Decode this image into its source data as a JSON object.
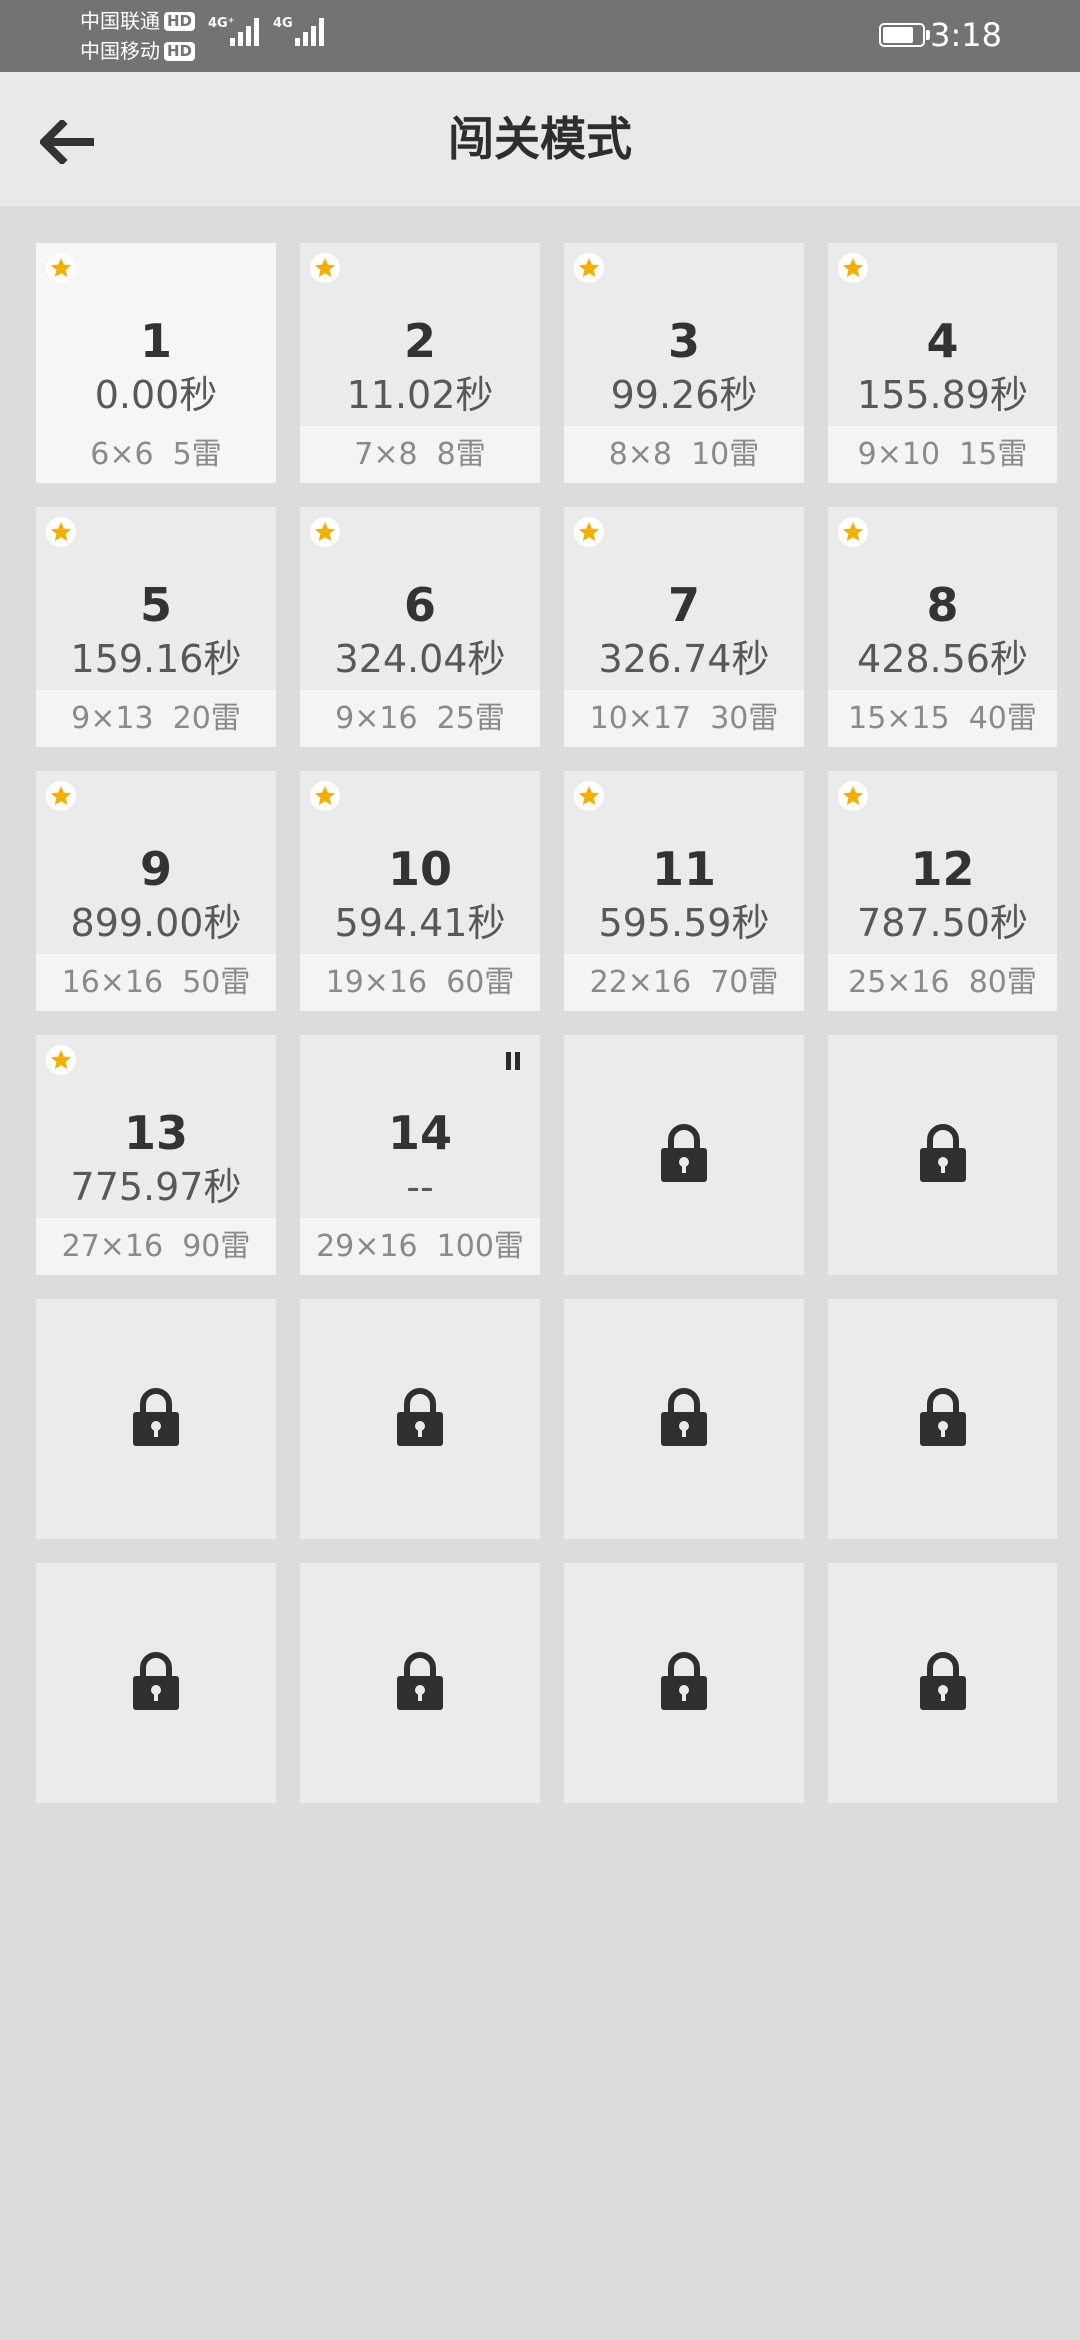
{
  "status_bar": {
    "carrier1": "中国联通",
    "carrier2": "中国移动",
    "hd_label": "HD",
    "net1": "4G⁺",
    "net2": "4G",
    "time": "3:18",
    "battery_level": 0.8
  },
  "header": {
    "title": "闯关模式",
    "back_icon": "arrow-left-icon"
  },
  "levels": [
    {
      "num": "1",
      "time": "0.00秒",
      "size": "6×6",
      "mines": "5雷",
      "state": "completed"
    },
    {
      "num": "2",
      "time": "11.02秒",
      "size": "7×8",
      "mines": "8雷",
      "state": "completed"
    },
    {
      "num": "3",
      "time": "99.26秒",
      "size": "8×8",
      "mines": "10雷",
      "state": "completed"
    },
    {
      "num": "4",
      "time": "155.89秒",
      "size": "9×10",
      "mines": "15雷",
      "state": "completed"
    },
    {
      "num": "5",
      "time": "159.16秒",
      "size": "9×13",
      "mines": "20雷",
      "state": "completed"
    },
    {
      "num": "6",
      "time": "324.04秒",
      "size": "9×16",
      "mines": "25雷",
      "state": "completed"
    },
    {
      "num": "7",
      "time": "326.74秒",
      "size": "10×17",
      "mines": "30雷",
      "state": "completed"
    },
    {
      "num": "8",
      "time": "428.56秒",
      "size": "15×15",
      "mines": "40雷",
      "state": "completed"
    },
    {
      "num": "9",
      "time": "899.00秒",
      "size": "16×16",
      "mines": "50雷",
      "state": "completed"
    },
    {
      "num": "10",
      "time": "594.41秒",
      "size": "19×16",
      "mines": "60雷",
      "state": "completed"
    },
    {
      "num": "11",
      "time": "595.59秒",
      "size": "22×16",
      "mines": "70雷",
      "state": "completed"
    },
    {
      "num": "12",
      "time": "787.50秒",
      "size": "25×16",
      "mines": "80雷",
      "state": "completed"
    },
    {
      "num": "13",
      "time": "775.97秒",
      "size": "27×16",
      "mines": "90雷",
      "state": "completed"
    },
    {
      "num": "14",
      "time": "--",
      "size": "29×16",
      "mines": "100雷",
      "state": "paused"
    },
    {
      "state": "locked"
    },
    {
      "state": "locked"
    },
    {
      "state": "locked"
    },
    {
      "state": "locked"
    },
    {
      "state": "locked"
    },
    {
      "state": "locked"
    },
    {
      "state": "locked"
    },
    {
      "state": "locked"
    },
    {
      "state": "locked"
    },
    {
      "state": "locked"
    }
  ],
  "colors": {
    "star": "#f4b000",
    "lock": "#2f2f2f"
  },
  "icons": {
    "completed": "star-icon",
    "paused": "pause-icon",
    "locked": "lock-icon"
  }
}
